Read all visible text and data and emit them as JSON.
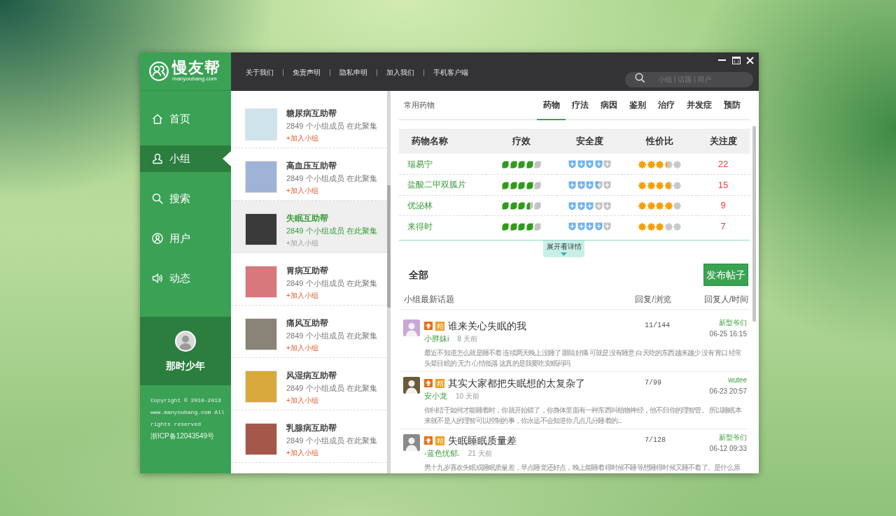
{
  "logo": {
    "name": "慢友帮",
    "domain": "manyoubang.com"
  },
  "sidebar": {
    "items": [
      {
        "label": "首页",
        "selected": false
      },
      {
        "label": "小组",
        "selected": true
      },
      {
        "label": "搜索",
        "selected": false
      },
      {
        "label": "用户",
        "selected": false
      },
      {
        "label": "动态",
        "selected": false
      }
    ],
    "user": {
      "name": "那时少年"
    },
    "copyright": "Copyright © 2010-2013 www.manyoubang.com All rights reserved",
    "icp": "浙ICP备12043549号"
  },
  "top_links": [
    "关于我们",
    "免责声明",
    "隐私申明",
    "加入我们",
    "手机客户端"
  ],
  "search": {
    "placeholder": "小组 | 话题 | 用户"
  },
  "groups": [
    {
      "title": "糖尿病互助帮",
      "members": "2849 个小组成员 在此聚集",
      "join": "+加入小组",
      "selected": false
    },
    {
      "title": "高血压互助帮",
      "members": "2849 个小组成员 在此聚集",
      "join": "+加入小组",
      "selected": false
    },
    {
      "title": "失眠互助帮",
      "members": "2849 个小组成员 在此聚集",
      "join": "+加入小组",
      "selected": true
    },
    {
      "title": "胃病互助帮",
      "members": "2849 个小组成员 在此聚集",
      "join": "+加入小组",
      "selected": false
    },
    {
      "title": "痛风互助帮",
      "members": "2849 个小组成员 在此聚集",
      "join": "+加入小组",
      "selected": false
    },
    {
      "title": "风湿病互助帮",
      "members": "2849 个小组成员 在此聚集",
      "join": "+加入小组",
      "selected": false
    },
    {
      "title": "乳腺病互助帮",
      "members": "2849 个小组成员 在此聚集",
      "join": "+加入小组",
      "selected": false
    }
  ],
  "panel": {
    "title": "常用药物",
    "tabs": [
      {
        "label": "药物",
        "selected": true
      },
      {
        "label": "疗法",
        "selected": false
      },
      {
        "label": "病因",
        "selected": false
      },
      {
        "label": "鉴别",
        "selected": false
      },
      {
        "label": "治疗",
        "selected": false
      },
      {
        "label": "并发症",
        "selected": false
      },
      {
        "label": "预防",
        "selected": false
      }
    ]
  },
  "drug_table": {
    "columns": [
      "药物名称",
      "疗效",
      "安全度",
      "性价比",
      "关注度"
    ],
    "rows": [
      {
        "name": "瑞易宁",
        "efficacy": {
          "stars": 4
        },
        "safety": {
          "stars": 4
        },
        "value": {
          "stars": 3.3
        },
        "attention": "22"
      },
      {
        "name": "盐酸二甲双胍片",
        "efficacy": {
          "stars": 4
        },
        "safety": {
          "stars": 3.5
        },
        "value": {
          "stars": 3.7
        },
        "attention": "15"
      },
      {
        "name": "优泌林",
        "efficacy": {
          "stars": 3.5
        },
        "safety": {
          "stars": 3
        },
        "value": {
          "stars": 4
        },
        "attention": "9"
      },
      {
        "name": "来得时",
        "efficacy": {
          "stars": 4
        },
        "safety": {
          "stars": 4
        },
        "value": {
          "stars": 3
        },
        "attention": "7"
      }
    ]
  },
  "expand_button": "展开看详情",
  "topics": {
    "filter": "全部",
    "post_button": "发布帖子",
    "columns": [
      "小组最新话题",
      "回复/浏览",
      "回复人/时间"
    ],
    "posts": [
      {
        "pinned": true,
        "badge": "精",
        "title": "谁来关心失眠的我",
        "author": "小胖妹i",
        "age": "8 天前",
        "excerpt": "最近不知道怎么就是睡不着 连续两天晚上没睡了 眼睛好痛 可就是没有睡意 白天吃的东西越来越少 没有胃口 经常头晕目眩的 无力 心情低落 这真的是我要吃安眠药吗",
        "replies_views": "11/144",
        "replier": "新型爷们",
        "time": "06-25 16:15"
      },
      {
        "pinned": true,
        "badge": "精",
        "title": "其实大家都把失眠想的太复杂了",
        "author": "安小龙",
        "age": "10 天前",
        "excerpt": "你纠结于如何才能睡着时，你就开始错了，你身体里面有一种东西叫植物神经，他不归你的理智管。 所以睡眠本来就不是人的理智可以控制的事，你永远不会知道你几点几分睡着的...",
        "replies_views": "7/99",
        "replier": "wutee",
        "time": "06-23 20:57"
      },
      {
        "pinned": true,
        "badge": "精",
        "title": "失眠睡眠质量差",
        "author": "-蓝色忧郁.",
        "age": "21 天前",
        "excerpt": "男十九岁喜欢失眠或睡眠质量差，早点睡觉还好点，晚上能睡着得时候不睡等想睡得时候又睡不着了。是什么原",
        "replies_views": "7/128",
        "replier": "新型爷们",
        "time": "06-12 09:33"
      }
    ]
  }
}
